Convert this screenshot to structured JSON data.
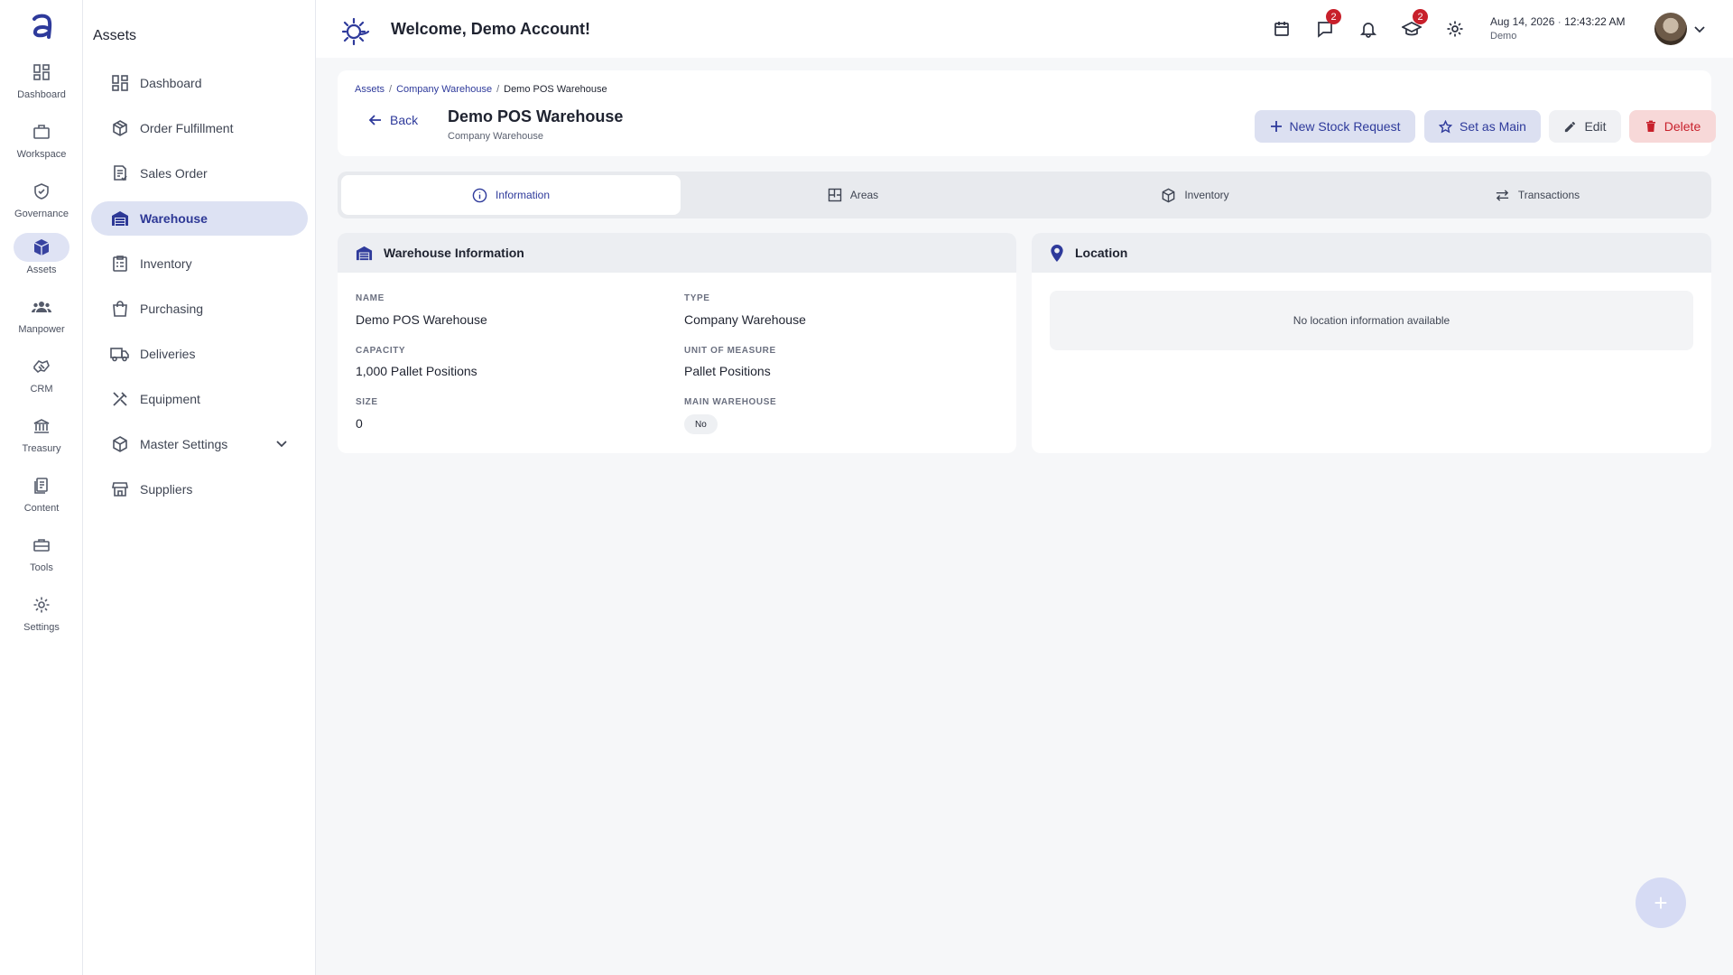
{
  "header": {
    "welcome": "Welcome, Demo Account!",
    "chat_badge": "2",
    "learn_badge": "2",
    "date": "Aug 14, 2026",
    "time": "12:43:22 AM",
    "user": "Demo"
  },
  "rail": {
    "items": [
      {
        "label": "Dashboard",
        "icon": "grid-icon"
      },
      {
        "label": "Workspace",
        "icon": "briefcase-icon"
      },
      {
        "label": "Governance",
        "icon": "shield-icon"
      },
      {
        "label": "Assets",
        "icon": "cube-icon"
      },
      {
        "label": "Manpower",
        "icon": "people-icon"
      },
      {
        "label": "CRM",
        "icon": "handshake-icon"
      },
      {
        "label": "Treasury",
        "icon": "bank-icon"
      },
      {
        "label": "Content",
        "icon": "document-icon"
      },
      {
        "label": "Tools",
        "icon": "toolbox-icon"
      },
      {
        "label": "Settings",
        "icon": "gear-icon"
      }
    ]
  },
  "sidebar": {
    "title": "Assets",
    "items": [
      {
        "label": "Dashboard"
      },
      {
        "label": "Order Fulfillment"
      },
      {
        "label": "Sales Order"
      },
      {
        "label": "Warehouse"
      },
      {
        "label": "Inventory"
      },
      {
        "label": "Purchasing"
      },
      {
        "label": "Deliveries"
      },
      {
        "label": "Equipment"
      },
      {
        "label": "Master Settings"
      },
      {
        "label": "Suppliers"
      }
    ]
  },
  "breadcrumb": {
    "items": [
      "Assets",
      "Company Warehouse",
      "Demo POS Warehouse"
    ],
    "sep": "/"
  },
  "page": {
    "back": "Back",
    "title": "Demo POS Warehouse",
    "subtitle": "Company Warehouse"
  },
  "actions": {
    "new_stock": "New Stock Request",
    "set_main": "Set as Main",
    "edit": "Edit",
    "delete": "Delete"
  },
  "tabs": [
    {
      "label": "Information",
      "active": true
    },
    {
      "label": "Areas",
      "active": false
    },
    {
      "label": "Inventory",
      "active": false
    },
    {
      "label": "Transactions",
      "active": false
    }
  ],
  "info": {
    "title": "Warehouse Information",
    "fields": {
      "name_label": "NAME",
      "name": "Demo POS Warehouse",
      "type_label": "TYPE",
      "type": "Company Warehouse",
      "capacity_label": "CAPACITY",
      "capacity": "1,000 Pallet Positions",
      "uom_label": "UNIT OF MEASURE",
      "uom": "Pallet Positions",
      "size_label": "SIZE",
      "size": "0",
      "main_label": "MAIN WAREHOUSE",
      "main": "No"
    }
  },
  "location": {
    "title": "Location",
    "empty": "No location information available"
  },
  "fab": {
    "label": "+"
  },
  "colors": {
    "accent": "#2e3a9b",
    "danger": "#c8202b",
    "active_bg": "#dde2f3"
  }
}
